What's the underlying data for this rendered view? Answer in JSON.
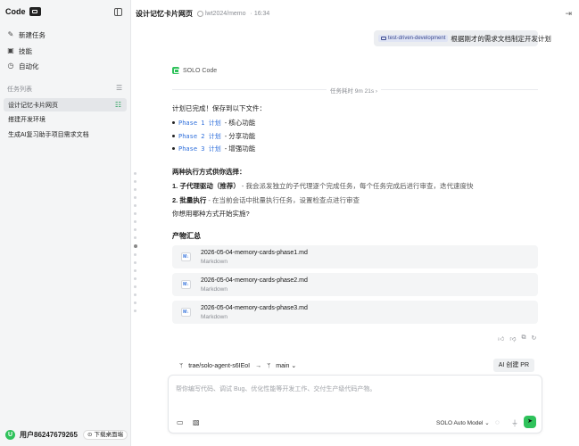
{
  "sidebar": {
    "brand": "Code",
    "nav": [
      {
        "label": "新建任务",
        "icon": "edit-icon"
      },
      {
        "label": "技能",
        "icon": "skill-icon"
      },
      {
        "label": "自动化",
        "icon": "automation-icon"
      }
    ],
    "section_title": "任务列表",
    "tasks": [
      {
        "label": "设计记忆卡片网页",
        "active": true
      },
      {
        "label": "搭建开发环境",
        "active": false
      },
      {
        "label": "生成AI复习助手项目需求文档",
        "active": false
      }
    ],
    "user": "用户86247679265",
    "download": "下载桌面端"
  },
  "topbar": {
    "title": "设计记忆卡片网页",
    "repo": "lwt2024/memo",
    "time": "16:34"
  },
  "user_message": {
    "tag": "test-driven-development",
    "text": "根据刚才的需求文档制定开发计划"
  },
  "agent": {
    "name": "SOLO Code",
    "duration": "任务耗时 9m 21s"
  },
  "content": {
    "intro": "计划已完成！保存到以下文件：",
    "phases": [
      {
        "code": "Phase 1 计划",
        "desc": "- 核心功能"
      },
      {
        "code": "Phase 2 计划",
        "desc": "- 分享功能"
      },
      {
        "code": "Phase 3 计划",
        "desc": "- 增强功能"
      }
    ],
    "options_title": "两种执行方式供你选择：",
    "option1_bold": "1. 子代理驱动（推荐）",
    "option1_text": " - 我会派发独立的子代理逐个完成任务，每个任务完成后进行审查，迭代速度快",
    "option2_bold": "2. 批量执行",
    "option2_text": " - 在当前会话中批量执行任务，设置检查点进行审查",
    "question": "你想用哪种方式开始实施?",
    "artifacts_title": "产物汇总",
    "files": [
      {
        "name": "2026-05-04-memory-cards-phase1.md",
        "type": "Markdown"
      },
      {
        "name": "2026-05-04-memory-cards-phase2.md",
        "type": "Markdown"
      },
      {
        "name": "2026-05-04-memory-cards-phase3.md",
        "type": "Markdown"
      }
    ],
    "file_icon": "M↓"
  },
  "composer": {
    "branch": "trae/solo-agent-s6IEoI",
    "base": "main",
    "pr_button": "AI 创建 PR",
    "placeholder": "帮你编写代码、调试 Bug、优化性能等开发工作、交付生产级代码产物。",
    "model": "SOLO Auto Model"
  }
}
